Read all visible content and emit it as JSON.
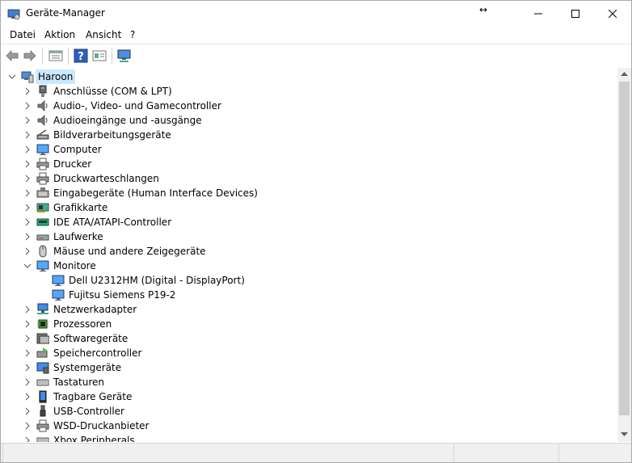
{
  "window": {
    "title": "Geräte-Manager",
    "controls": {
      "minimize": "—",
      "maximize": "☐",
      "close": "✕"
    },
    "resize_indicator": "↔"
  },
  "menu": [
    {
      "label": "Datei"
    },
    {
      "label": "Aktion"
    },
    {
      "label": "Ansicht"
    },
    {
      "label": "?"
    }
  ],
  "toolbar": {
    "icons": [
      "back-arrow-icon",
      "forward-arrow-icon",
      "properties-icon",
      "help-icon",
      "update-driver-icon",
      "scan-hardware-icon"
    ]
  },
  "tree": {
    "root": {
      "label": "Haroon",
      "icon": "computer-root-icon",
      "expanded": true
    },
    "categories": [
      {
        "label": "Anschlüsse (COM & LPT)",
        "icon": "port-icon"
      },
      {
        "label": "Audio-, Video- und Gamecontroller",
        "icon": "speaker-icon"
      },
      {
        "label": "Audioeingänge und -ausgänge",
        "icon": "speaker-icon"
      },
      {
        "label": "Bildverarbeitungsgeräte",
        "icon": "scanner-icon"
      },
      {
        "label": "Computer",
        "icon": "monitor-icon"
      },
      {
        "label": "Drucker",
        "icon": "printer-icon"
      },
      {
        "label": "Druckwarteschlangen",
        "icon": "printer-icon"
      },
      {
        "label": "Eingabegeräte (Human Interface Devices)",
        "icon": "hid-icon"
      },
      {
        "label": "Grafikkarte",
        "icon": "display-adapter-icon"
      },
      {
        "label": "IDE ATA/ATAPI-Controller",
        "icon": "ide-icon"
      },
      {
        "label": "Laufwerke",
        "icon": "disk-drive-icon"
      },
      {
        "label": "Mäuse und andere Zeigegeräte",
        "icon": "mouse-icon"
      },
      {
        "label": "Monitore",
        "icon": "monitor-icon",
        "expanded": true,
        "children": [
          {
            "label": "Dell U2312HM (Digital - DisplayPort)",
            "icon": "monitor-icon"
          },
          {
            "label": "Fujitsu Siemens P19-2",
            "icon": "monitor-icon"
          }
        ]
      },
      {
        "label": "Netzwerkadapter",
        "icon": "network-icon"
      },
      {
        "label": "Prozessoren",
        "icon": "processor-icon"
      },
      {
        "label": "Softwaregeräte",
        "icon": "software-device-icon"
      },
      {
        "label": "Speichercontroller",
        "icon": "storage-controller-icon"
      },
      {
        "label": "Systemgeräte",
        "icon": "system-device-icon"
      },
      {
        "label": "Tastaturen",
        "icon": "keyboard-icon"
      },
      {
        "label": "Tragbare Geräte",
        "icon": "portable-device-icon"
      },
      {
        "label": "USB-Controller",
        "icon": "usb-icon"
      },
      {
        "label": "WSD-Druckanbieter",
        "icon": "printer-icon"
      },
      {
        "label": "Xbox Peripherals",
        "icon": "keyboard-icon"
      }
    ]
  }
}
